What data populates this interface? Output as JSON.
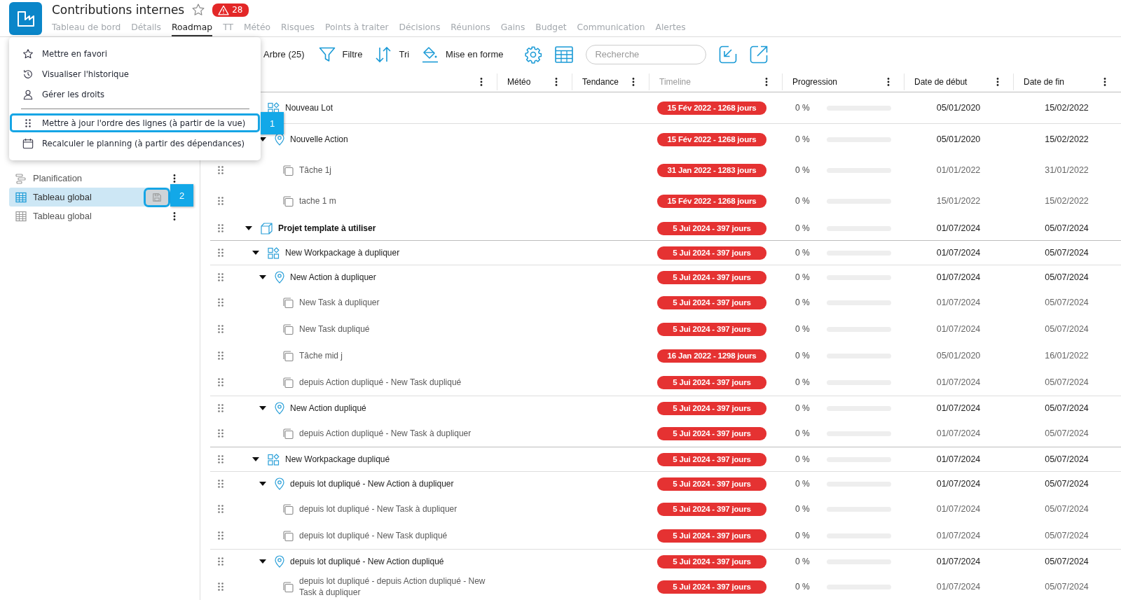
{
  "app": {
    "title": "Contributions internes",
    "favorite": false,
    "alert_count": "28"
  },
  "tabs": [
    {
      "label": "Tableau de bord",
      "selected": false
    },
    {
      "label": "Détails",
      "selected": false
    },
    {
      "label": "Roadmap",
      "selected": true
    },
    {
      "label": "TT",
      "selected": false
    },
    {
      "label": "Météo",
      "selected": false
    },
    {
      "label": "Risques",
      "selected": false
    },
    {
      "label": "Points à traiter",
      "selected": false
    },
    {
      "label": "Décisions",
      "selected": false
    },
    {
      "label": "Réunions",
      "selected": false
    },
    {
      "label": "Gains",
      "selected": false
    },
    {
      "label": "Budget",
      "selected": false
    },
    {
      "label": "Communication",
      "selected": false
    },
    {
      "label": "Alertes",
      "selected": false
    }
  ],
  "menu": {
    "items": [
      {
        "label": "Mettre en favori",
        "kind": "star",
        "highlighted": false
      },
      {
        "label": "Visualiser l'historique",
        "kind": "history",
        "highlighted": false
      },
      {
        "label": "Gérer les droits",
        "kind": "user",
        "highlighted": false
      },
      {
        "label": "Mettre à jour l'ordre des lignes (à partir de la vue)",
        "kind": "drag",
        "highlighted": true,
        "callout": "1"
      },
      {
        "label": "Recalculer le planning (à partir des dépendances)",
        "kind": "calendar",
        "highlighted": false
      }
    ]
  },
  "sidebar": {
    "items": [
      {
        "label": "Planification",
        "kind": "planning",
        "selected": false
      },
      {
        "label": "Tableau global",
        "kind": "table",
        "selected": true,
        "callout": "2"
      },
      {
        "label": "Tableau global",
        "kind": "table",
        "selected": false
      }
    ]
  },
  "toolbar": {
    "view_label": "Arbre (25)",
    "buttons": [
      {
        "label": "Filtre",
        "kind": "filter"
      },
      {
        "label": "Tri",
        "kind": "sort"
      },
      {
        "label": "Mise en forme",
        "kind": "format"
      }
    ],
    "search": {
      "placeholder": "Recherche"
    }
  },
  "table": {
    "columns": [
      {
        "label": "Météo",
        "disabled": false
      },
      {
        "label": "Tendance",
        "disabled": false
      },
      {
        "label": "Timeline",
        "disabled": true
      },
      {
        "label": "Progression",
        "disabled": false
      },
      {
        "label": "Date de début",
        "disabled": false
      },
      {
        "label": "Date de fin",
        "disabled": false
      }
    ],
    "rows": [
      {
        "name": "Nouveau Lot",
        "kind": "workpackage",
        "timeline": "15 Fév 2022 - 1268 jours",
        "progress": "0 %",
        "level": 0,
        "start": "05/01/2020",
        "end": "15/02/2022",
        "children": [
          {
            "name": "Nouvelle Action",
            "kind": "action",
            "expanded": true,
            "timeline": "15 Fév 2022 - 1268 jours",
            "progress": "0 %",
            "level": 0,
            "start": "05/01/2020",
            "end": "15/02/2022",
            "children": [
              {
                "name": "Tâche 1j",
                "kind": "task",
                "timeline": "31 Jan 2022 - 1283 jours",
                "progress": "0 %",
                "level": 0,
                "start": "01/01/2022",
                "end": "31/01/2022"
              },
              {
                "name": "tache 1 m",
                "kind": "task",
                "timeline": "15 Fév 2022 - 1268 jours",
                "progress": "0 %",
                "level": 0,
                "start": "15/01/2022",
                "end": "15/02/2022"
              }
            ]
          }
        ]
      },
      {
        "name": "Projet template à utiliser",
        "kind": "project",
        "expanded": true,
        "timeline": "5 Jui 2024 - 397 jours",
        "progress": "0 %",
        "level": 0,
        "start": "01/07/2024",
        "end": "05/07/2024",
        "children": [
          {
            "name": "New Workpackage à dupliquer",
            "kind": "workpackage",
            "expanded": true,
            "timeline": "5 Jui 2024 - 397 jours",
            "progress": "0 %",
            "level": 0,
            "start": "01/07/2024",
            "end": "05/07/2024",
            "children": [
              {
                "name": "New Action à dupliquer",
                "kind": "action",
                "expanded": true,
                "timeline": "5 Jui 2024 - 397 jours",
                "progress": "0 %",
                "level": 0,
                "start": "01/07/2024",
                "end": "05/07/2024",
                "children": [
                  {
                    "name": "New Task à dupliquer",
                    "kind": "task",
                    "timeline": "5 Jui 2024 - 397 jours",
                    "progress": "0 %",
                    "level": 0,
                    "start": "01/07/2024",
                    "end": "05/07/2024"
                  },
                  {
                    "name": "New Task dupliqué",
                    "kind": "task",
                    "timeline": "5 Jui 2024 - 397 jours",
                    "progress": "0 %",
                    "level": 0,
                    "start": "01/07/2024",
                    "end": "05/07/2024"
                  },
                  {
                    "name": "Tâche mid j",
                    "kind": "task",
                    "timeline": "16 Jan 2022 - 1298 jours",
                    "progress": "0 %",
                    "level": 0,
                    "start": "05/01/2020",
                    "end": "16/01/2022"
                  },
                  {
                    "name": "depuis Action dupliqué - New Task dupliqué",
                    "kind": "task",
                    "timeline": "5 Jui 2024 - 397 jours",
                    "progress": "0 %",
                    "level": 0,
                    "start": "01/07/2024",
                    "end": "05/07/2024"
                  }
                ]
              },
              {
                "name": "New Action dupliqué",
                "kind": "action",
                "expanded": true,
                "timeline": "5 Jui 2024 - 397 jours",
                "progress": "0 %",
                "level": 0,
                "start": "01/07/2024",
                "end": "05/07/2024",
                "children": [
                  {
                    "name": "depuis Action dupliqué - New Task à dupliquer",
                    "kind": "task",
                    "timeline": "5 Jui 2024 - 397 jours",
                    "progress": "0 %",
                    "level": 0,
                    "start": "01/07/2024",
                    "end": "05/07/2024"
                  }
                ]
              }
            ]
          },
          {
            "name": "New Workpackage dupliqué",
            "kind": "workpackage",
            "expanded": true,
            "timeline": "5 Jui 2024 - 397 jours",
            "progress": "0 %",
            "level": 0,
            "start": "01/07/2024",
            "end": "05/07/2024",
            "children": [
              {
                "name": "depuis lot dupliqué - New Action à dupliquer",
                "kind": "action",
                "expanded": true,
                "timeline": "5 Jui 2024 - 397 jours",
                "progress": "0 %",
                "level": 0,
                "start": "01/07/2024",
                "end": "05/07/2024",
                "children": [
                  {
                    "name": "depuis lot dupliqué - New Task à dupliquer",
                    "kind": "task",
                    "timeline": "5 Jui 2024 - 397 jours",
                    "progress": "0 %",
                    "level": 0,
                    "start": "01/07/2024",
                    "end": "05/07/2024"
                  },
                  {
                    "name": "depuis lot dupliqué - New Task dupliqué",
                    "kind": "task",
                    "timeline": "5 Jui 2024 - 397 jours",
                    "progress": "0 %",
                    "level": 0,
                    "start": "01/07/2024",
                    "end": "05/07/2024"
                  }
                ]
              },
              {
                "name": "depuis lot dupliqué - New Action dupliqué",
                "kind": "action",
                "expanded": true,
                "timeline": "5 Jui 2024 - 397 jours",
                "progress": "0 %",
                "level": 0,
                "start": "01/07/2024",
                "end": "05/07/2024",
                "children": [
                  {
                    "name": "depuis lot dupliqué - depuis Action dupliqué - New Task à dupliquer",
                    "kind": "task",
                    "timeline": "5 Jui 2024 - 397 jours",
                    "progress": "0 %",
                    "level": 0,
                    "start": "01/07/2024",
                    "end": "05/07/2024"
                  }
                ]
              }
            ]
          }
        ]
      }
    ]
  }
}
